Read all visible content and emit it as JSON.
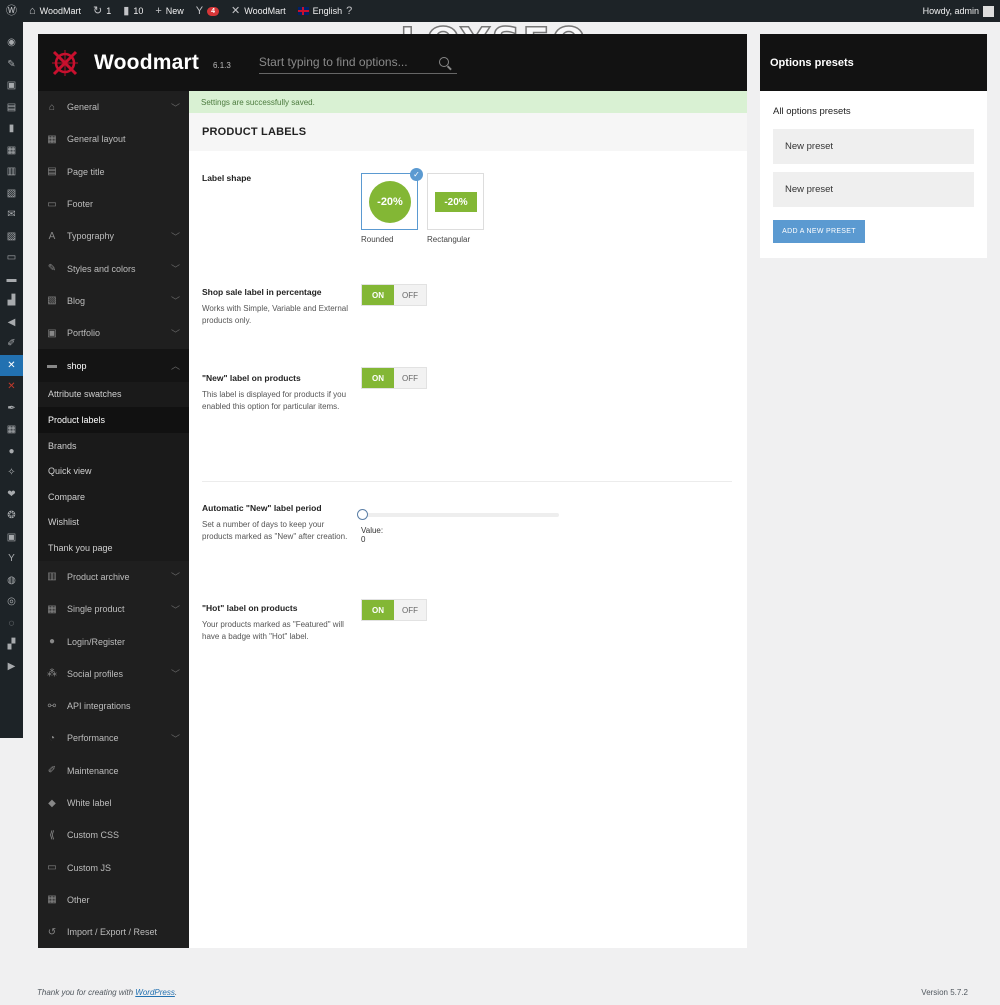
{
  "admin_bar": {
    "site_name": "WoodMart",
    "updates_count": "1",
    "comments_count": "10",
    "new_label": "New",
    "yoast_badge": "4",
    "theme_label": "WoodMart",
    "language_label": "English",
    "howdy": "Howdy, admin"
  },
  "watermark": "LOYSEO",
  "header": {
    "logo_text": "Woodmart",
    "version": "6.1.3",
    "search_placeholder": "Start typing to find options..."
  },
  "nav": {
    "items": [
      {
        "label": "General",
        "icon": "home-icon",
        "chevron": true
      },
      {
        "label": "General layout",
        "icon": "layout-icon",
        "chevron": false
      },
      {
        "label": "Page title",
        "icon": "page-title-icon",
        "chevron": false
      },
      {
        "label": "Footer",
        "icon": "footer-icon",
        "chevron": false
      },
      {
        "label": "Typography",
        "icon": "typography-icon",
        "chevron": true
      },
      {
        "label": "Styles and colors",
        "icon": "brush-icon",
        "chevron": true
      },
      {
        "label": "Blog",
        "icon": "blog-icon",
        "chevron": true
      },
      {
        "label": "Portfolio",
        "icon": "portfolio-icon",
        "chevron": true
      },
      {
        "label": "shop",
        "icon": "cart-icon",
        "chevron": true
      }
    ],
    "shop_subitems": [
      "Attribute swatches",
      "Product labels",
      "Brands",
      "Quick view",
      "Compare",
      "Wishlist",
      "Thank you page"
    ],
    "items_after": [
      {
        "label": "Product archive",
        "icon": "store-icon",
        "chevron": true
      },
      {
        "label": "Single product",
        "icon": "product-icon",
        "chevron": true
      },
      {
        "label": "Login/Register",
        "icon": "user-icon",
        "chevron": false
      },
      {
        "label": "Social profiles",
        "icon": "share-icon",
        "chevron": true
      },
      {
        "label": "API integrations",
        "icon": "api-icon",
        "chevron": false
      },
      {
        "label": "Performance",
        "icon": "performance-icon",
        "chevron": true
      },
      {
        "label": "Maintenance",
        "icon": "wrench-icon",
        "chevron": false
      },
      {
        "label": "White label",
        "icon": "tag-icon",
        "chevron": false
      },
      {
        "label": "Custom CSS",
        "icon": "css-icon",
        "chevron": false
      },
      {
        "label": "Custom JS",
        "icon": "js-icon",
        "chevron": false
      },
      {
        "label": "Other",
        "icon": "other-icon",
        "chevron": false
      },
      {
        "label": "Import / Export / Reset",
        "icon": "reset-icon",
        "chevron": false
      }
    ]
  },
  "notice": "Settings are successfully saved.",
  "section_title": "PRODUCT LABELS",
  "options": {
    "label_shape": {
      "title": "Label shape",
      "choices": [
        {
          "caption": "Rounded",
          "sample": "-20%",
          "selected": true
        },
        {
          "caption": "Rectangular",
          "sample": "-20%",
          "selected": false
        }
      ]
    },
    "sale_percentage": {
      "title": "Shop sale label in percentage",
      "desc": "Works with Simple, Variable and External products only.",
      "on": "ON",
      "off": "OFF",
      "value": "ON"
    },
    "new_label": {
      "title": "\"New\" label on products",
      "desc": "This label is displayed for products if you enabled this option for particular items.",
      "on": "ON",
      "off": "OFF",
      "value": "ON"
    },
    "new_period": {
      "title": "Automatic \"New\" label period",
      "desc": "Set a number of days to keep your products marked as \"New\" after creation.",
      "value_text": "Value: 0",
      "value": 0
    },
    "hot_label": {
      "title": "\"Hot\" label on products",
      "desc": "Your products marked as \"Featured\" will have a badge with \"Hot\" label.",
      "on": "ON",
      "off": "OFF",
      "value": "ON"
    }
  },
  "presets": {
    "title": "Options presets",
    "subtitle": "All options presets",
    "items": [
      "New preset",
      "New preset"
    ],
    "add_button": "ADD A NEW PRESET"
  },
  "footer": {
    "thanks_prefix": "Thank you for creating with ",
    "thanks_link": "WordPress",
    "thanks_suffix": ".",
    "version": "Version 5.7.2"
  },
  "colors": {
    "accent_green": "#83b735",
    "accent_blue": "#5b9ad1",
    "wp_admin_dark": "#1d2327",
    "panel_dark": "#121212"
  }
}
